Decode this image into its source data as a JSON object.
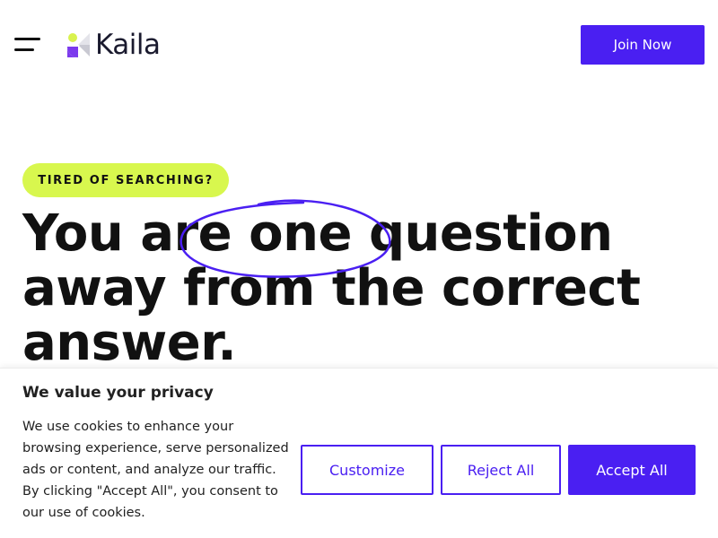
{
  "header": {
    "logo_text": "Kaila",
    "join_label": "Join Now"
  },
  "hero": {
    "badge": "TIRED OF SEARCHING?",
    "headline": "You are one question away from the correct answer."
  },
  "cookie_banner": {
    "title": "We value your privacy",
    "body": "We use cookies to enhance your browsing experience, serve personalized ads or content, and analyze our traffic. By clicking \"Accept All\", you consent to our use of cookies.",
    "customize_label": "Customize",
    "reject_label": "Reject All",
    "accept_label": "Accept All"
  },
  "colors": {
    "brand_purple": "#4a1ff2",
    "badge_lime": "#d8f74e",
    "logo_purple": "#7c3aed",
    "logo_lime": "#d9f24e",
    "text_dark": "#111111"
  },
  "icons": [
    "menu-icon",
    "kaila-logo-mark"
  ]
}
